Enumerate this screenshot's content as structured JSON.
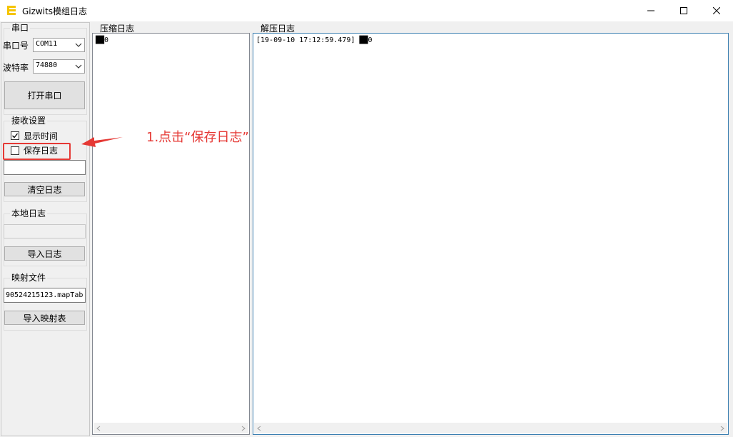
{
  "window": {
    "title": "Gizwits模组日志"
  },
  "serial": {
    "group_label": "串口",
    "port_label": "串口号",
    "port_value": "COM11",
    "baud_label": "波特率",
    "baud_value": "74880",
    "open_button": "打开串口"
  },
  "receive": {
    "group_label": "接收设置",
    "show_time_label": "显示时间",
    "show_time_checked": true,
    "save_log_label": "保存日志",
    "save_log_checked": false,
    "clear_button": "清空日志"
  },
  "local_log": {
    "group_label": "本地日志",
    "import_button": "导入日志"
  },
  "mapping": {
    "group_label": "映射文件",
    "file_value": "90524215123.mapTab",
    "import_button": "导入映射表"
  },
  "compressed_log": {
    "label": "压缩日志",
    "content": "██0"
  },
  "decompressed_log": {
    "label": "解压日志",
    "content": "[19-09-10 17:12:59.479] ██0"
  },
  "annotation": {
    "text": "1.点击“保存日志”",
    "color": "#e53935"
  }
}
